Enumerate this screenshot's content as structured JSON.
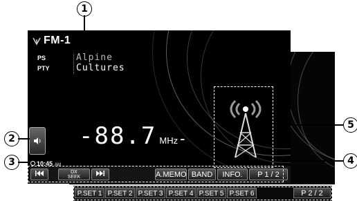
{
  "callouts": [
    "1",
    "2",
    "3",
    "4",
    "5"
  ],
  "source": {
    "antenna_icon": "antenna-signal-icon",
    "band_label": "FM-1"
  },
  "rds": {
    "ps_label": "PS",
    "ps_value": "Alpine",
    "pty_label": "PTY",
    "pty_value": "Cultures"
  },
  "frequency": {
    "value": "-88.7",
    "unit": "MHz",
    "trailing_dash": "-"
  },
  "side_button": {
    "icon": "speaker-volume-icon"
  },
  "clock": {
    "time": "10:45",
    "ampm": "AM"
  },
  "toolbar_p1": {
    "prev_icon": "skip-previous-icon",
    "dx_seek_line1": "DX",
    "dx_seek_line2": "SEEK",
    "next_icon": "skip-next-icon",
    "amemo": "A.MEMO",
    "band": "BAND",
    "info": "INFO.",
    "page": "P  1 / 2"
  },
  "toolbar_p2": {
    "preset_labels": [
      "P.SET 1",
      "P.SET 2",
      "P.SET 3",
      "P.SET 4",
      "P.SET 5",
      "P.SET 6"
    ],
    "page": "P  2 / 2"
  },
  "tower_icon": "broadcast-tower-icon"
}
